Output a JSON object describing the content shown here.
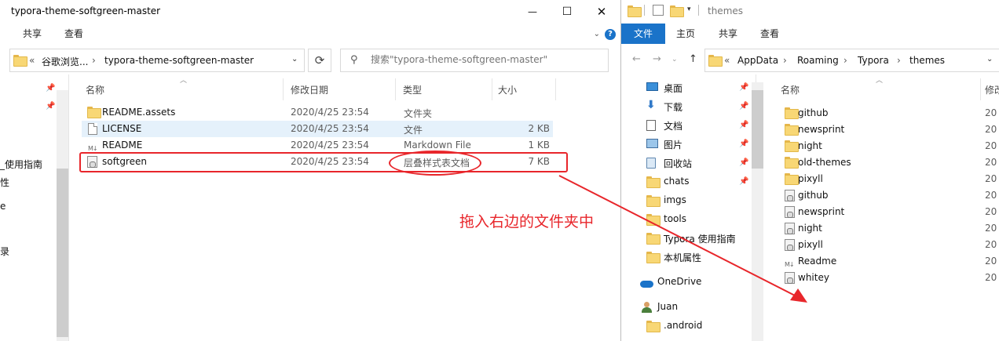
{
  "left_window": {
    "title": "typora-theme-softgreen-master",
    "controls": {
      "minimize": "—",
      "maximize": "☐",
      "close": "✕"
    },
    "ribbon_tabs": [
      "共享",
      "查看"
    ],
    "address": {
      "prefix": "«",
      "crumbs": [
        "谷歌浏览...",
        "typora-theme-softgreen-master"
      ],
      "separator": "›"
    },
    "search_placeholder": "搜索\"typora-theme-softgreen-master\"",
    "nav_fragments": [
      "_使用指南",
      "性",
      "e",
      "",
      "录"
    ],
    "columns": {
      "name": "名称",
      "date": "修改日期",
      "type": "类型",
      "size": "大小"
    },
    "files": [
      {
        "name": "README.assets",
        "date": "2020/4/25 23:54",
        "type": "文件夹",
        "size": "",
        "icon": "folder-icon"
      },
      {
        "name": "LICENSE",
        "date": "2020/4/25 23:54",
        "type": "文件",
        "size": "2 KB",
        "icon": "file-icon"
      },
      {
        "name": "README",
        "date": "2020/4/25 23:54",
        "type": "Markdown File",
        "size": "1 KB",
        "icon": "markdown-icon"
      },
      {
        "name": "softgreen",
        "date": "2020/4/25 23:54",
        "type": "层叠样式表文档",
        "size": "7 KB",
        "icon": "css-file-icon"
      }
    ]
  },
  "annotation": {
    "text": "拖入右边的文件夹中",
    "color": "#e8262b"
  },
  "right_window": {
    "title": "themes",
    "file_tab": "文件",
    "ribbon_tabs": [
      "主页",
      "共享",
      "查看"
    ],
    "address": {
      "prefix": "«",
      "crumbs": [
        "AppData",
        "Roaming",
        "Typora",
        "themes"
      ],
      "separator": "›"
    },
    "columns": {
      "name": "名称",
      "date": "修改"
    },
    "nav": [
      {
        "label": "桌面",
        "icon": "desktop-icon",
        "pinned": true
      },
      {
        "label": "下载",
        "icon": "download-icon",
        "pinned": true
      },
      {
        "label": "文档",
        "icon": "documents-icon",
        "pinned": true
      },
      {
        "label": "图片",
        "icon": "pictures-icon",
        "pinned": true
      },
      {
        "label": "回收站",
        "icon": "recycle-bin-icon",
        "pinned": true
      },
      {
        "label": "chats",
        "icon": "folder-icon",
        "pinned": true
      },
      {
        "label": "imgs",
        "icon": "folder-icon",
        "pinned": false
      },
      {
        "label": "tools",
        "icon": "folder-icon",
        "pinned": false
      },
      {
        "label": "Typora 使用指南",
        "icon": "folder-icon",
        "pinned": false
      },
      {
        "label": "本机属性",
        "icon": "folder-icon",
        "pinned": false
      },
      {
        "label": "OneDrive",
        "icon": "onedrive-icon",
        "pinned": false
      },
      {
        "label": "Juan",
        "icon": "user-icon",
        "pinned": false
      },
      {
        "label": ".android",
        "icon": "folder-icon",
        "pinned": false
      }
    ],
    "files": [
      {
        "name": "github",
        "icon": "folder-icon",
        "date": "20"
      },
      {
        "name": "newsprint",
        "icon": "folder-icon",
        "date": "20"
      },
      {
        "name": "night",
        "icon": "folder-icon",
        "date": "20"
      },
      {
        "name": "old-themes",
        "icon": "folder-icon",
        "date": "20"
      },
      {
        "name": "pixyll",
        "icon": "folder-icon",
        "date": "20"
      },
      {
        "name": "github",
        "icon": "css-file-icon",
        "date": "20"
      },
      {
        "name": "newsprint",
        "icon": "css-file-icon",
        "date": "20"
      },
      {
        "name": "night",
        "icon": "css-file-icon",
        "date": "20"
      },
      {
        "name": "pixyll",
        "icon": "css-file-icon",
        "date": "20"
      },
      {
        "name": "Readme",
        "icon": "markdown-icon",
        "date": "20"
      },
      {
        "name": "whitey",
        "icon": "css-file-icon",
        "date": "20"
      }
    ]
  }
}
